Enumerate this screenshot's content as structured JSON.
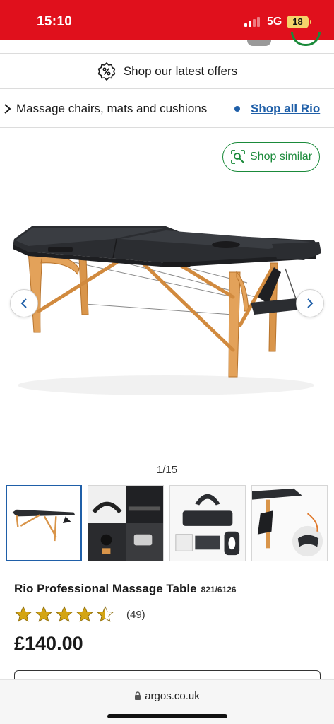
{
  "status_bar": {
    "time": "15:10",
    "network": "5G",
    "battery": "18"
  },
  "offers": {
    "label": "Shop our latest offers",
    "icon": "discount-badge-icon"
  },
  "breadcrumb": {
    "category": "Massage chairs, mats and cushions",
    "link": "Shop all Rio"
  },
  "shop_similar": {
    "label": "Shop similar",
    "icon": "visual-search-icon"
  },
  "gallery": {
    "counter": "1/15",
    "thumbnail_count": 4,
    "selected_index": 0
  },
  "product": {
    "title": "Rio Professional Massage Table",
    "code": "821/6126",
    "rating": 4.5,
    "review_count": "(49)",
    "price": "£140.00"
  },
  "browser": {
    "url": "argos.co.uk"
  },
  "colors": {
    "brand_red": "#e0101c",
    "link_blue": "#1f5fa8",
    "accent_green": "#1a8a3a",
    "star_gold": "#d4a514"
  }
}
